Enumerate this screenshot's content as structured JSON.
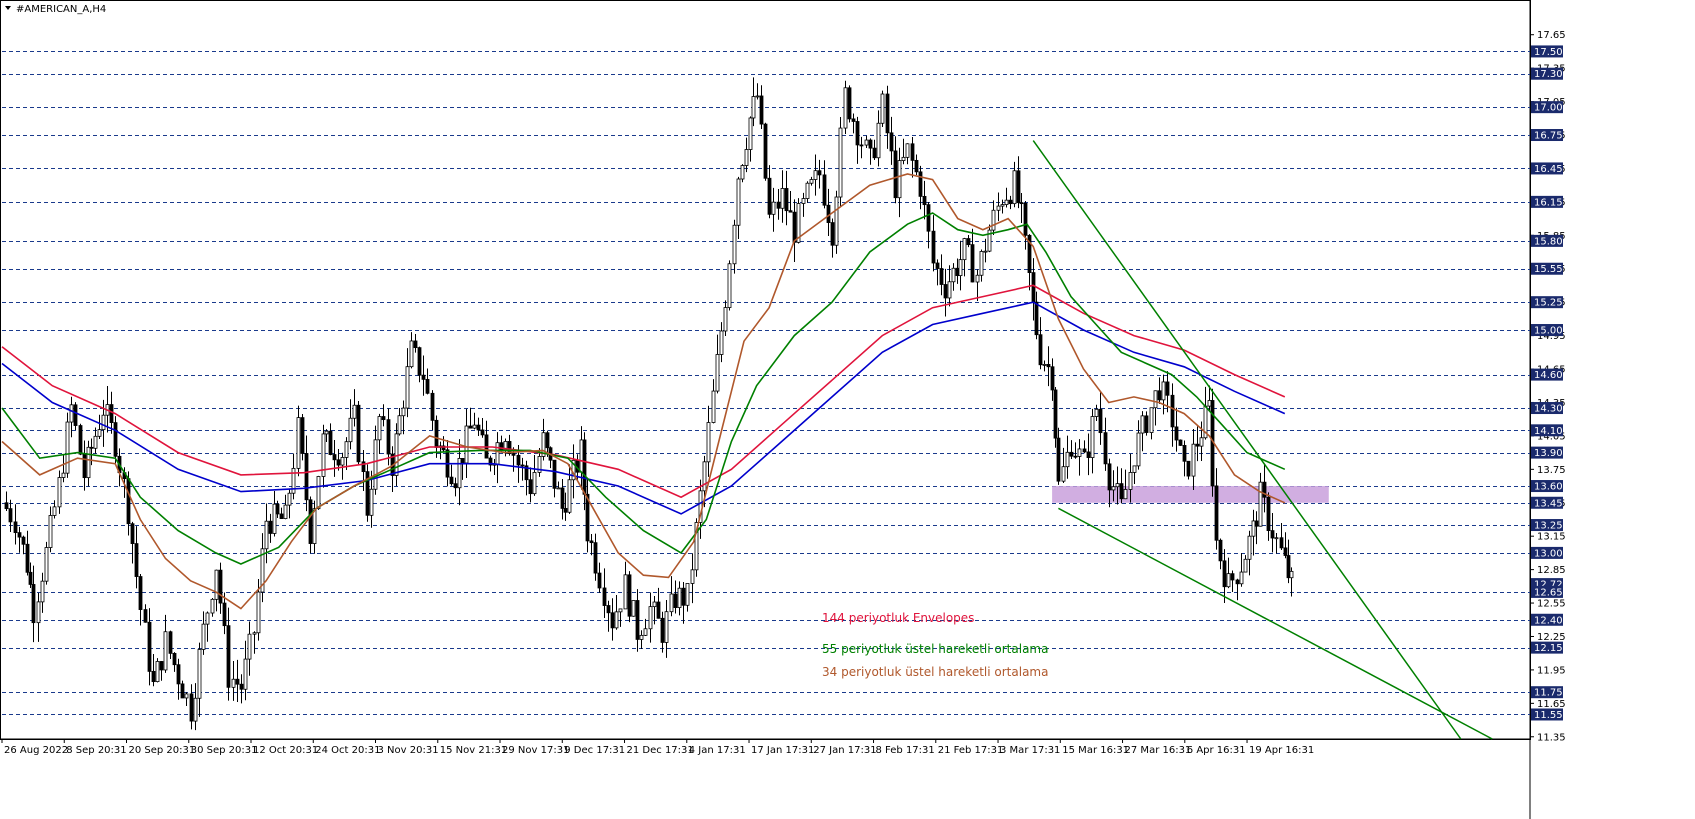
{
  "window": {
    "title": "#AMERICAN_A,H4",
    "menu_icon": "triangle-down-icon"
  },
  "chart_data": {
    "type": "candlestick",
    "symbol": "#AMERICAN_A",
    "timeframe": "H4",
    "y_range": [
      11.33,
      17.8
    ],
    "x_range": [
      0,
      100
    ],
    "right_scale_ticks": [
      17.65,
      17.35,
      17.05,
      16.75,
      16.45,
      16.15,
      15.85,
      15.55,
      15.25,
      14.95,
      14.65,
      14.35,
      14.05,
      13.75,
      13.45,
      13.15,
      12.85,
      12.55,
      12.25,
      11.95,
      11.65,
      11.35
    ],
    "horizontal_levels": [
      17.5,
      17.3,
      17.0,
      16.75,
      16.45,
      16.15,
      15.8,
      15.55,
      15.25,
      15.0,
      14.6,
      14.3,
      14.1,
      13.9,
      13.6,
      13.45,
      13.25,
      13.0,
      12.65,
      12.4,
      12.15,
      11.75,
      11.55
    ],
    "highlighted_levels": [
      17.5,
      17.3,
      17.0,
      16.75,
      16.45,
      16.15,
      15.8,
      15.55,
      15.25,
      15.0,
      14.6,
      14.3,
      14.1,
      13.9,
      13.6,
      13.45,
      13.25,
      13.0,
      12.72,
      12.65,
      12.4,
      12.15,
      11.75,
      11.55
    ],
    "highlighted_labels": [
      "17.50",
      "17.30",
      "17.00",
      "16.75",
      "16.45",
      "16.15",
      "15.80",
      "15.55",
      "15.25",
      "15.00",
      "14.60",
      "14.30",
      "14.10",
      "13.90",
      "13.60",
      "13.45",
      "13.25",
      "13.00",
      "12.72",
      "12.65",
      "12.40",
      "12.15",
      "11.75",
      "11.55"
    ],
    "x_labels": [
      {
        "x": 0,
        "label": "26 Aug 2022"
      },
      {
        "x": 4.95,
        "label": "8 Sep 20:31"
      },
      {
        "x": 9.9,
        "label": "20 Sep 20:31"
      },
      {
        "x": 14.85,
        "label": "30 Sep 20:31"
      },
      {
        "x": 19.8,
        "label": "12 Oct 20:31"
      },
      {
        "x": 24.75,
        "label": "24 Oct 20:31"
      },
      {
        "x": 29.7,
        "label": "3 Nov 20:31"
      },
      {
        "x": 34.65,
        "label": "15 Nov 21:31"
      },
      {
        "x": 39.6,
        "label": "29 Nov 17:31"
      },
      {
        "x": 44.55,
        "label": "9 Dec 17:31"
      },
      {
        "x": 49.5,
        "label": "21 Dec 17:31"
      },
      {
        "x": 54.45,
        "label": "4 Jan 17:31"
      },
      {
        "x": 59.4,
        "label": "17 Jan 17:31"
      },
      {
        "x": 64.35,
        "label": "27 Jan 17:31"
      },
      {
        "x": 69.3,
        "label": "8 Feb 17:31"
      },
      {
        "x": 74.25,
        "label": "21 Feb 17:31"
      },
      {
        "x": 79.2,
        "label": "3 Mar 17:31"
      },
      {
        "x": 84.15,
        "label": "15 Mar 16:31"
      },
      {
        "x": 89.1,
        "label": "27 Mar 16:31"
      },
      {
        "x": 94.05,
        "label": "6 Apr 16:31"
      },
      {
        "x": 99.0,
        "label": "19 Apr 16:31"
      }
    ],
    "price_path": [
      {
        "x": 0,
        "y": 13.45
      },
      {
        "x": 1,
        "y": 13.3
      },
      {
        "x": 2,
        "y": 12.9
      },
      {
        "x": 2.5,
        "y": 12.5
      },
      {
        "x": 3.5,
        "y": 13.0
      },
      {
        "x": 4.5,
        "y": 13.6
      },
      {
        "x": 5.5,
        "y": 14.3
      },
      {
        "x": 6.5,
        "y": 13.7
      },
      {
        "x": 8,
        "y": 14.3
      },
      {
        "x": 9,
        "y": 14.0
      },
      {
        "x": 10,
        "y": 13.4
      },
      {
        "x": 11,
        "y": 12.5
      },
      {
        "x": 12,
        "y": 11.8
      },
      {
        "x": 13,
        "y": 12.2
      },
      {
        "x": 14,
        "y": 11.9
      },
      {
        "x": 15,
        "y": 11.6
      },
      {
        "x": 16,
        "y": 12.3
      },
      {
        "x": 17,
        "y": 12.9
      },
      {
        "x": 18,
        "y": 11.9
      },
      {
        "x": 19,
        "y": 11.8
      },
      {
        "x": 20,
        "y": 12.3
      },
      {
        "x": 21,
        "y": 13.3
      },
      {
        "x": 22.5,
        "y": 13.3
      },
      {
        "x": 23.5,
        "y": 14.1
      },
      {
        "x": 24.5,
        "y": 13.2
      },
      {
        "x": 25.5,
        "y": 14.0
      },
      {
        "x": 27,
        "y": 13.9
      },
      {
        "x": 28,
        "y": 14.2
      },
      {
        "x": 29,
        "y": 13.4
      },
      {
        "x": 30,
        "y": 14.2
      },
      {
        "x": 31,
        "y": 13.8
      },
      {
        "x": 32.5,
        "y": 14.8
      },
      {
        "x": 33.5,
        "y": 14.6
      },
      {
        "x": 34.5,
        "y": 14.0
      },
      {
        "x": 36,
        "y": 13.7
      },
      {
        "x": 37.5,
        "y": 14.2
      },
      {
        "x": 38.5,
        "y": 13.8
      },
      {
        "x": 40,
        "y": 14.1
      },
      {
        "x": 41,
        "y": 13.8
      },
      {
        "x": 42,
        "y": 13.6
      },
      {
        "x": 43,
        "y": 14.0
      },
      {
        "x": 44.5,
        "y": 13.4
      },
      {
        "x": 46,
        "y": 13.9
      },
      {
        "x": 46.5,
        "y": 13.2
      },
      {
        "x": 47.5,
        "y": 12.8
      },
      {
        "x": 48.5,
        "y": 12.4
      },
      {
        "x": 49.5,
        "y": 12.7
      },
      {
        "x": 50.5,
        "y": 12.3
      },
      {
        "x": 51.5,
        "y": 12.5
      },
      {
        "x": 52.5,
        "y": 12.3
      },
      {
        "x": 53.5,
        "y": 12.6
      },
      {
        "x": 54.5,
        "y": 12.6
      },
      {
        "x": 55.5,
        "y": 13.5
      },
      {
        "x": 56.5,
        "y": 14.4
      },
      {
        "x": 57.5,
        "y": 15.3
      },
      {
        "x": 58.5,
        "y": 16.4
      },
      {
        "x": 59.5,
        "y": 16.9
      },
      {
        "x": 60,
        "y": 17.1
      },
      {
        "x": 61,
        "y": 16.0
      },
      {
        "x": 62,
        "y": 16.2
      },
      {
        "x": 63,
        "y": 15.9
      },
      {
        "x": 64,
        "y": 16.2
      },
      {
        "x": 65,
        "y": 16.4
      },
      {
        "x": 66,
        "y": 15.9
      },
      {
        "x": 67,
        "y": 17.1
      },
      {
        "x": 68,
        "y": 16.8
      },
      {
        "x": 69,
        "y": 16.5
      },
      {
        "x": 70,
        "y": 17.0
      },
      {
        "x": 71,
        "y": 16.3
      },
      {
        "x": 72,
        "y": 16.6
      },
      {
        "x": 73,
        "y": 16.3
      },
      {
        "x": 74,
        "y": 15.6
      },
      {
        "x": 75,
        "y": 15.4
      },
      {
        "x": 76.5,
        "y": 15.7
      },
      {
        "x": 77.5,
        "y": 15.5
      },
      {
        "x": 78.5,
        "y": 15.9
      },
      {
        "x": 79.5,
        "y": 16.2
      },
      {
        "x": 80.5,
        "y": 16.3
      },
      {
        "x": 81,
        "y": 16.0
      },
      {
        "x": 82,
        "y": 15.2
      },
      {
        "x": 82.5,
        "y": 14.8
      },
      {
        "x": 83.5,
        "y": 14.6
      },
      {
        "x": 84,
        "y": 13.6
      },
      {
        "x": 85,
        "y": 14.0
      },
      {
        "x": 86,
        "y": 13.8
      },
      {
        "x": 87,
        "y": 14.3
      },
      {
        "x": 88,
        "y": 13.7
      },
      {
        "x": 89,
        "y": 13.4
      },
      {
        "x": 90,
        "y": 13.9
      },
      {
        "x": 91,
        "y": 14.2
      },
      {
        "x": 92,
        "y": 14.5
      },
      {
        "x": 93,
        "y": 14.2
      },
      {
        "x": 94,
        "y": 13.7
      },
      {
        "x": 95,
        "y": 14.0
      },
      {
        "x": 96,
        "y": 14.3
      },
      {
        "x": 96.5,
        "y": 13.1
      },
      {
        "x": 97.5,
        "y": 12.7
      },
      {
        "x": 98.5,
        "y": 12.9
      },
      {
        "x": 99.5,
        "y": 13.2
      },
      {
        "x": 100,
        "y": 13.5
      },
      {
        "x": 101,
        "y": 13.2
      },
      {
        "x": 102,
        "y": 12.9
      },
      {
        "x": 102.5,
        "y": 12.72
      }
    ],
    "series": [
      {
        "name": "144 periyotluk Envelopes",
        "color": "#e0143c",
        "points": [
          {
            "x": 0,
            "y": 14.85
          },
          {
            "x": 4,
            "y": 14.5
          },
          {
            "x": 9,
            "y": 14.25
          },
          {
            "x": 14,
            "y": 13.9
          },
          {
            "x": 19,
            "y": 13.7
          },
          {
            "x": 24,
            "y": 13.72
          },
          {
            "x": 29,
            "y": 13.8
          },
          {
            "x": 34,
            "y": 13.95
          },
          {
            "x": 39,
            "y": 13.95
          },
          {
            "x": 44,
            "y": 13.88
          },
          {
            "x": 49,
            "y": 13.75
          },
          {
            "x": 54,
            "y": 13.5
          },
          {
            "x": 58,
            "y": 13.75
          },
          {
            "x": 62,
            "y": 14.15
          },
          {
            "x": 66,
            "y": 14.55
          },
          {
            "x": 70,
            "y": 14.95
          },
          {
            "x": 74,
            "y": 15.2
          },
          {
            "x": 78,
            "y": 15.3
          },
          {
            "x": 82,
            "y": 15.4
          },
          {
            "x": 86,
            "y": 15.15
          },
          {
            "x": 90,
            "y": 14.95
          },
          {
            "x": 94,
            "y": 14.82
          },
          {
            "x": 98,
            "y": 14.6
          },
          {
            "x": 102,
            "y": 14.4
          }
        ]
      },
      {
        "name": "",
        "color": "#0000cc",
        "points": [
          {
            "x": 0,
            "y": 14.7
          },
          {
            "x": 4,
            "y": 14.35
          },
          {
            "x": 9,
            "y": 14.1
          },
          {
            "x": 14,
            "y": 13.75
          },
          {
            "x": 19,
            "y": 13.55
          },
          {
            "x": 24,
            "y": 13.58
          },
          {
            "x": 29,
            "y": 13.65
          },
          {
            "x": 34,
            "y": 13.8
          },
          {
            "x": 39,
            "y": 13.8
          },
          {
            "x": 44,
            "y": 13.73
          },
          {
            "x": 49,
            "y": 13.6
          },
          {
            "x": 54,
            "y": 13.35
          },
          {
            "x": 58,
            "y": 13.6
          },
          {
            "x": 62,
            "y": 14.0
          },
          {
            "x": 66,
            "y": 14.4
          },
          {
            "x": 70,
            "y": 14.8
          },
          {
            "x": 74,
            "y": 15.05
          },
          {
            "x": 78,
            "y": 15.15
          },
          {
            "x": 82,
            "y": 15.25
          },
          {
            "x": 86,
            "y": 15.0
          },
          {
            "x": 90,
            "y": 14.8
          },
          {
            "x": 94,
            "y": 14.67
          },
          {
            "x": 98,
            "y": 14.45
          },
          {
            "x": 102,
            "y": 14.25
          }
        ]
      },
      {
        "name": "55 periyotluk üstel hareketli ortalama",
        "color": "#008000",
        "points": [
          {
            "x": 0,
            "y": 14.3
          },
          {
            "x": 3,
            "y": 13.85
          },
          {
            "x": 6,
            "y": 13.9
          },
          {
            "x": 9,
            "y": 13.85
          },
          {
            "x": 11,
            "y": 13.5
          },
          {
            "x": 14,
            "y": 13.2
          },
          {
            "x": 17,
            "y": 13.0
          },
          {
            "x": 19,
            "y": 12.9
          },
          {
            "x": 22,
            "y": 13.05
          },
          {
            "x": 25,
            "y": 13.4
          },
          {
            "x": 28,
            "y": 13.6
          },
          {
            "x": 31,
            "y": 13.75
          },
          {
            "x": 34,
            "y": 13.9
          },
          {
            "x": 38,
            "y": 13.92
          },
          {
            "x": 42,
            "y": 13.92
          },
          {
            "x": 45,
            "y": 13.85
          },
          {
            "x": 48,
            "y": 13.5
          },
          {
            "x": 51,
            "y": 13.2
          },
          {
            "x": 54,
            "y": 13.0
          },
          {
            "x": 56,
            "y": 13.3
          },
          {
            "x": 58,
            "y": 14.0
          },
          {
            "x": 60,
            "y": 14.5
          },
          {
            "x": 63,
            "y": 14.95
          },
          {
            "x": 66,
            "y": 15.25
          },
          {
            "x": 69,
            "y": 15.7
          },
          {
            "x": 72,
            "y": 15.95
          },
          {
            "x": 74,
            "y": 16.05
          },
          {
            "x": 76,
            "y": 15.9
          },
          {
            "x": 78,
            "y": 15.85
          },
          {
            "x": 80,
            "y": 15.9
          },
          {
            "x": 81.5,
            "y": 15.95
          },
          {
            "x": 83,
            "y": 15.7
          },
          {
            "x": 85,
            "y": 15.3
          },
          {
            "x": 87,
            "y": 15.05
          },
          {
            "x": 89,
            "y": 14.8
          },
          {
            "x": 91,
            "y": 14.7
          },
          {
            "x": 93,
            "y": 14.6
          },
          {
            "x": 95,
            "y": 14.4
          },
          {
            "x": 97,
            "y": 14.15
          },
          {
            "x": 99,
            "y": 13.9
          },
          {
            "x": 102,
            "y": 13.75
          }
        ]
      },
      {
        "name": "34 periyotluk üstel hareketli ortalama",
        "color": "#b0582c",
        "points": [
          {
            "x": 0,
            "y": 14.0
          },
          {
            "x": 3,
            "y": 13.7
          },
          {
            "x": 6,
            "y": 13.85
          },
          {
            "x": 9,
            "y": 13.8
          },
          {
            "x": 11,
            "y": 13.3
          },
          {
            "x": 13,
            "y": 12.95
          },
          {
            "x": 15,
            "y": 12.75
          },
          {
            "x": 17,
            "y": 12.65
          },
          {
            "x": 19,
            "y": 12.5
          },
          {
            "x": 21,
            "y": 12.75
          },
          {
            "x": 23,
            "y": 13.1
          },
          {
            "x": 25,
            "y": 13.4
          },
          {
            "x": 28,
            "y": 13.6
          },
          {
            "x": 31,
            "y": 13.78
          },
          {
            "x": 34,
            "y": 14.05
          },
          {
            "x": 37,
            "y": 13.95
          },
          {
            "x": 40,
            "y": 13.9
          },
          {
            "x": 43,
            "y": 13.92
          },
          {
            "x": 45,
            "y": 13.8
          },
          {
            "x": 47,
            "y": 13.4
          },
          {
            "x": 49,
            "y": 13.0
          },
          {
            "x": 51,
            "y": 12.8
          },
          {
            "x": 53,
            "y": 12.78
          },
          {
            "x": 55,
            "y": 13.1
          },
          {
            "x": 57,
            "y": 14.0
          },
          {
            "x": 59,
            "y": 14.9
          },
          {
            "x": 61,
            "y": 15.2
          },
          {
            "x": 63,
            "y": 15.8
          },
          {
            "x": 66,
            "y": 16.05
          },
          {
            "x": 69,
            "y": 16.3
          },
          {
            "x": 72,
            "y": 16.4
          },
          {
            "x": 74,
            "y": 16.35
          },
          {
            "x": 76,
            "y": 16.0
          },
          {
            "x": 78,
            "y": 15.9
          },
          {
            "x": 80,
            "y": 16.0
          },
          {
            "x": 82,
            "y": 15.75
          },
          {
            "x": 84,
            "y": 15.1
          },
          {
            "x": 86,
            "y": 14.65
          },
          {
            "x": 88,
            "y": 14.35
          },
          {
            "x": 90,
            "y": 14.4
          },
          {
            "x": 92,
            "y": 14.35
          },
          {
            "x": 94,
            "y": 14.25
          },
          {
            "x": 96,
            "y": 14.05
          },
          {
            "x": 98,
            "y": 13.7
          },
          {
            "x": 100,
            "y": 13.55
          },
          {
            "x": 102,
            "y": 13.45
          }
        ]
      }
    ],
    "trendlines": [
      {
        "color": "#008000",
        "from": {
          "x": 82,
          "y": 16.7
        },
        "to": {
          "x": 116,
          "y": 11.33
        }
      },
      {
        "color": "#008000",
        "from": {
          "x": 84,
          "y": 13.4
        },
        "to": {
          "x": 118.5,
          "y": 11.33
        }
      }
    ],
    "zone": {
      "color": "#c9a0dc",
      "y_top": 13.6,
      "y_bottom": 13.45,
      "x_start": 83.5,
      "x_end": 105.5
    },
    "legend": [
      {
        "text": "144 periyotluk Envelopes",
        "color": "#e0143c"
      },
      {
        "text": "55 periyotluk üstel hareketli ortalama",
        "color": "#008000"
      },
      {
        "text": "34 periyotluk üstel hareketli ortalama",
        "color": "#b0582c"
      }
    ],
    "current_price": "12.72",
    "colors": {
      "grid": "#1a3a8c",
      "highlight_bg": "#1a2a6c",
      "candle": "#000000",
      "background": "#ffffff"
    }
  }
}
